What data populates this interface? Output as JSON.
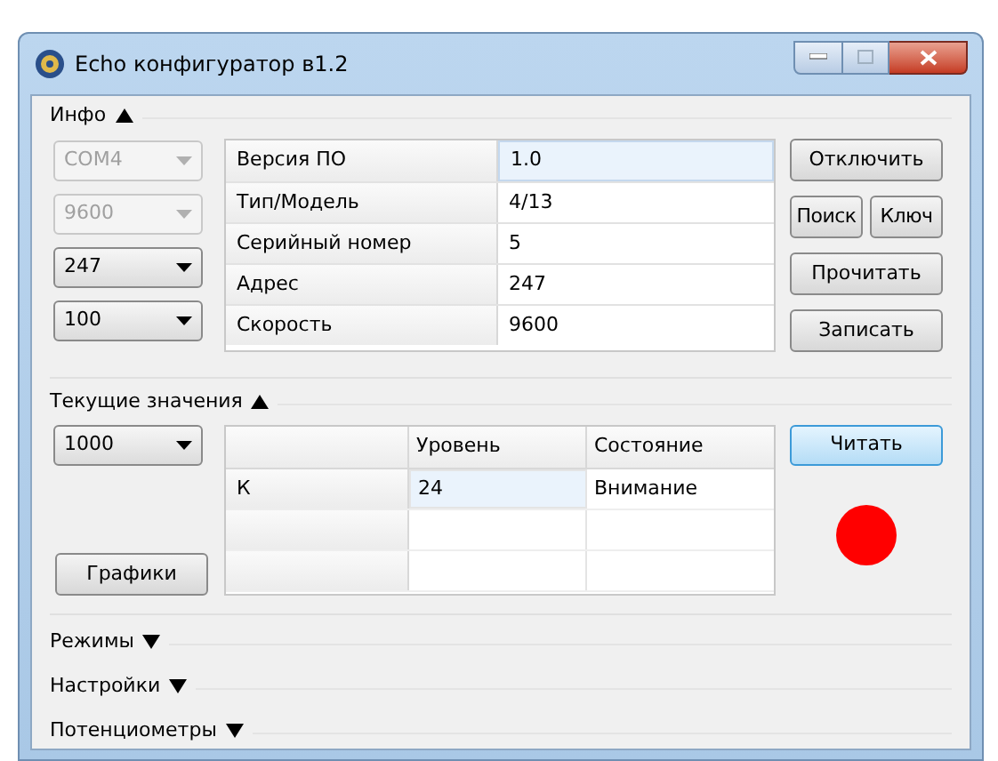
{
  "window": {
    "title": "Echo конфигуратор в1.2"
  },
  "info": {
    "title": "Инфо",
    "expanded": true,
    "combos": [
      {
        "value": "COM4",
        "disabled": true
      },
      {
        "value": "9600",
        "disabled": true
      },
      {
        "value": "247",
        "disabled": false
      },
      {
        "value": "100",
        "disabled": false
      }
    ],
    "rows": [
      {
        "label": "Версия ПО",
        "value": "1.0",
        "selected": true
      },
      {
        "label": "Тип/Модель",
        "value": "4/13",
        "selected": false
      },
      {
        "label": "Серийный номер",
        "value": "5",
        "selected": false
      },
      {
        "label": "Адрес",
        "value": "247",
        "selected": false
      },
      {
        "label": "Скорость",
        "value": "9600",
        "selected": false
      }
    ],
    "buttons": [
      "Отключить",
      "Поиск",
      "Ключ",
      "Прочитать",
      "Записать"
    ]
  },
  "current": {
    "title": "Текущие значения",
    "expanded": true,
    "combo": {
      "value": "1000",
      "disabled": false
    },
    "graphs_button": "Графики",
    "columns": [
      "",
      "Уровень",
      "Состояние"
    ],
    "rows": [
      {
        "cells": [
          "К",
          "24",
          "Внимание"
        ],
        "selected": true
      }
    ],
    "read_button": {
      "label": "Читать",
      "focused": true
    },
    "indicator": {
      "color": "#ff0000"
    }
  },
  "sections": [
    {
      "title": "Режимы",
      "expanded": false
    },
    {
      "title": "Настройки",
      "expanded": false
    },
    {
      "title": "Потенциометры",
      "expanded": false
    }
  ]
}
